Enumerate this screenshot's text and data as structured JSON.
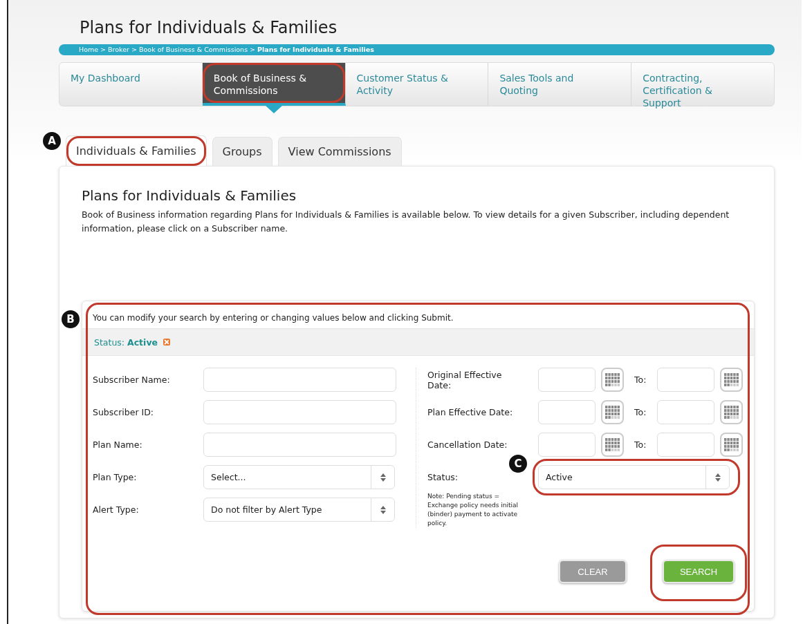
{
  "page_title": "Plans for Individuals & Families",
  "breadcrumb": "Home > Broker > Book of Business & Commissions > **Plans for Individuals & Families**",
  "nav": [
    {
      "label": "My Dashboard",
      "selected": false,
      "highlighted": false
    },
    {
      "label": "Book of Business & Commissions",
      "selected": true,
      "highlighted": true
    },
    {
      "label": "Customer Status & Activity",
      "selected": false,
      "highlighted": false
    },
    {
      "label": "Sales Tools and Quoting",
      "selected": false,
      "highlighted": false
    },
    {
      "label": "Contracting, Certification & Support",
      "selected": false,
      "highlighted": false
    }
  ],
  "tabs": [
    {
      "label": "Individuals & Families",
      "selected": true,
      "highlighted": true,
      "callout": "A"
    },
    {
      "label": "Groups",
      "selected": false,
      "highlighted": false
    },
    {
      "label": "View Commissions",
      "selected": false,
      "highlighted": false
    }
  ],
  "section": {
    "title": "Plans for Individuals & Families",
    "description": "Book of Business information regarding Plans for Individuals & Families is available below. To view details for a given Subscriber, including dependent information, please click on a Subscriber name."
  },
  "search_panel": {
    "callout": "B",
    "highlighted": true,
    "intro": "You can modify your search by entering or changing values below and clicking Submit.",
    "filter": {
      "label": "Status:",
      "value": "Active"
    },
    "left_fields": [
      {
        "label": "Subscriber Name:",
        "kind": "text"
      },
      {
        "label": "Subscriber ID:",
        "kind": "text"
      },
      {
        "label": "Plan Name:",
        "kind": "text"
      },
      {
        "label": "Plan Type:",
        "kind": "select",
        "value": "Select..."
      },
      {
        "label": "Alert Type:",
        "kind": "select",
        "value": "Do not filter by Alert Type"
      }
    ],
    "date_fields": [
      {
        "label": "Original Effective Date:",
        "to_label": "To:"
      },
      {
        "label": "Plan Effective Date:",
        "to_label": "To:"
      },
      {
        "label": "Cancellation Date:",
        "to_label": "To:"
      }
    ],
    "status": {
      "label": "Status:",
      "value": "Active",
      "highlighted": true,
      "callout": "C",
      "note": "Note: Pending status = Exchange policy needs initial (binder) payment to activate policy."
    },
    "buttons": [
      {
        "label": "CLEAR",
        "kind": "clear",
        "highlighted": false
      },
      {
        "label": "SEARCH",
        "kind": "search",
        "highlighted": true
      }
    ]
  }
}
